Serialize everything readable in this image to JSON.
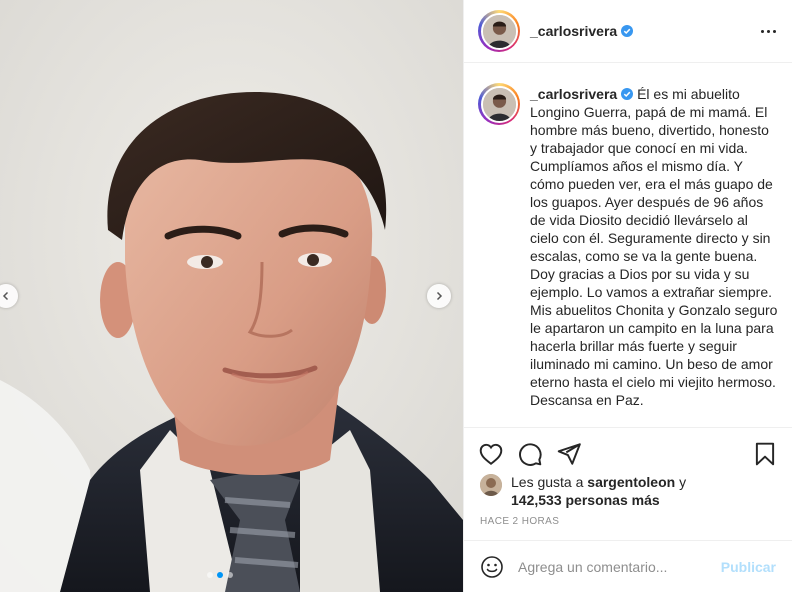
{
  "post": {
    "username": "_carlosrivera",
    "verified": true,
    "caption": "Él es mi abuelito Longino Guerra, papá de mi mamá. El hombre más bueno, divertido, honesto y trabajador que conocí en mi vida. Cumplíamos años el mismo día. Y cómo pueden ver, era el más guapo de los guapos. Ayer después de 96 años de vida Diosito decidió llevárselo al cielo con él. Seguramente directo y sin escalas, como se va la gente buena. Doy gracias a Dios por su vida y su ejemplo. Lo vamos a extrañar siempre. Mis abuelitos Chonita y Gonzalo seguro le apartaron un campito en la luna para hacerla brillar más fuerte y seguir iluminado mi camino. Un beso de amor eterno hasta el cielo mi viejito hermoso. Descansa en Paz.",
    "likes": {
      "prefix": "Les gusta a",
      "user": "sargentoleon",
      "conjunction": "y",
      "count": "142,533 personas más"
    },
    "time": "HACE 2 HORAS",
    "comment": {
      "placeholder": "Agrega un comentario...",
      "publish_label": "Publicar"
    },
    "carousel": {
      "slides": 3,
      "active": 1
    }
  },
  "icons": {
    "heart": "heart-icon",
    "comment": "comment-icon",
    "share": "share-icon",
    "save": "bookmark-icon",
    "emoji": "emoji-icon",
    "more": "more-options-icon",
    "verified": "verified-badge-icon",
    "prev": "chevron-left-icon",
    "next": "chevron-right-icon"
  },
  "colors": {
    "accent": "#0095f6",
    "publish_disabled": "#b2dffc",
    "text": "#262626",
    "muted": "#8e8e8e"
  }
}
